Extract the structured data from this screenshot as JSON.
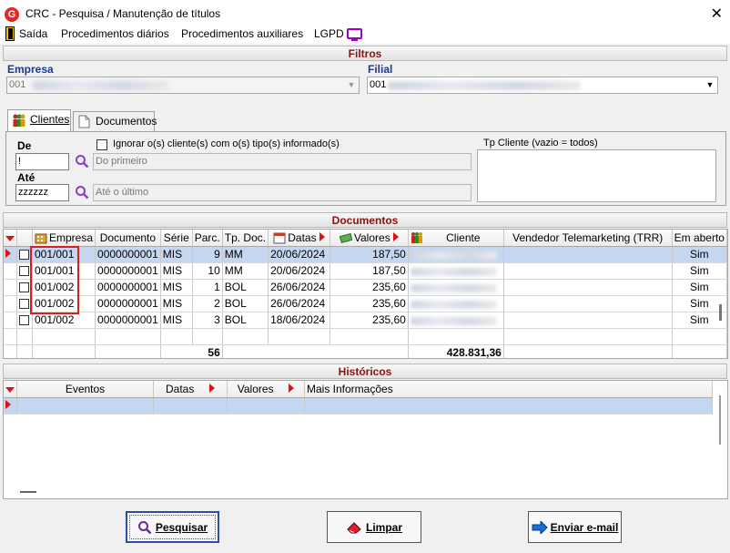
{
  "window": {
    "title": "CRC - Pesquisa / Manutenção de títulos",
    "close_glyph": "✕"
  },
  "menu": [
    {
      "label": "Saída",
      "icon": "exit-door-icon"
    },
    {
      "label": "Procedimentos diários"
    },
    {
      "label": "Procedimentos auxiliares"
    },
    {
      "label": "LGPD",
      "icon": "monitor-icon"
    }
  ],
  "filtros": {
    "header": "Filtros",
    "empresa_label": "Empresa",
    "empresa_value": "001",
    "filial_label": "Filial",
    "filial_value": "001"
  },
  "tabs": [
    {
      "label": "Clientes",
      "icon": "people-icon",
      "active": true
    },
    {
      "label": "Documentos",
      "icon": "document-icon",
      "active": false
    }
  ],
  "clientes": {
    "de_label": "De",
    "de_value": "!",
    "de_placeholder": "Do primeiro",
    "ate_label": "Até",
    "ate_value": "zzzzzz",
    "ate_placeholder": "Até o último",
    "ignorar_label": "Ignorar o(s) cliente(s) com o(s) tipo(s) informado(s)",
    "tp_cliente_label": "Tp Cliente (vazio = todos)"
  },
  "documentos": {
    "header": "Documentos",
    "columns": [
      "Empresa",
      "Documento",
      "Série",
      "Parc.",
      "Tp. Doc.",
      "Datas",
      "Valores",
      "Cliente",
      "Vendedor Telemarketing (TRR)",
      "Em aberto"
    ],
    "rows": [
      {
        "empresa": "001/001",
        "documento": "0000000001",
        "serie": "MIS",
        "parc": "9",
        "tp_doc": "MM",
        "data": "20/06/2024",
        "valor": "187,50",
        "em_aberto": "Sim",
        "selected": true
      },
      {
        "empresa": "001/001",
        "documento": "0000000001",
        "serie": "MIS",
        "parc": "10",
        "tp_doc": "MM",
        "data": "20/06/2024",
        "valor": "187,50",
        "em_aberto": "Sim"
      },
      {
        "empresa": "001/002",
        "documento": "0000000001",
        "serie": "MIS",
        "parc": "1",
        "tp_doc": "BOL",
        "data": "26/06/2024",
        "valor": "235,60",
        "em_aberto": "Sim"
      },
      {
        "empresa": "001/002",
        "documento": "0000000001",
        "serie": "MIS",
        "parc": "2",
        "tp_doc": "BOL",
        "data": "26/06/2024",
        "valor": "235,60",
        "em_aberto": "Sim"
      },
      {
        "empresa": "001/002",
        "documento": "0000000001",
        "serie": "MIS",
        "parc": "3",
        "tp_doc": "BOL",
        "data": "18/06/2024",
        "valor": "235,60",
        "em_aberto": "Sim"
      }
    ],
    "footer_count": "56",
    "footer_total": "428.831,36"
  },
  "historicos": {
    "header": "Históricos",
    "columns": [
      "Eventos",
      "Datas",
      "Valores",
      "Mais Informações"
    ]
  },
  "buttons": {
    "pesquisar": "Pesquisar",
    "limpar": "Limpar",
    "enviar": "Enviar e-mail"
  },
  "colors": {
    "section_header_text": "#8b1010",
    "label_blue": "#1c3a8c",
    "highlight_red": "#d42020",
    "selected_row": "#c5d7f0"
  }
}
